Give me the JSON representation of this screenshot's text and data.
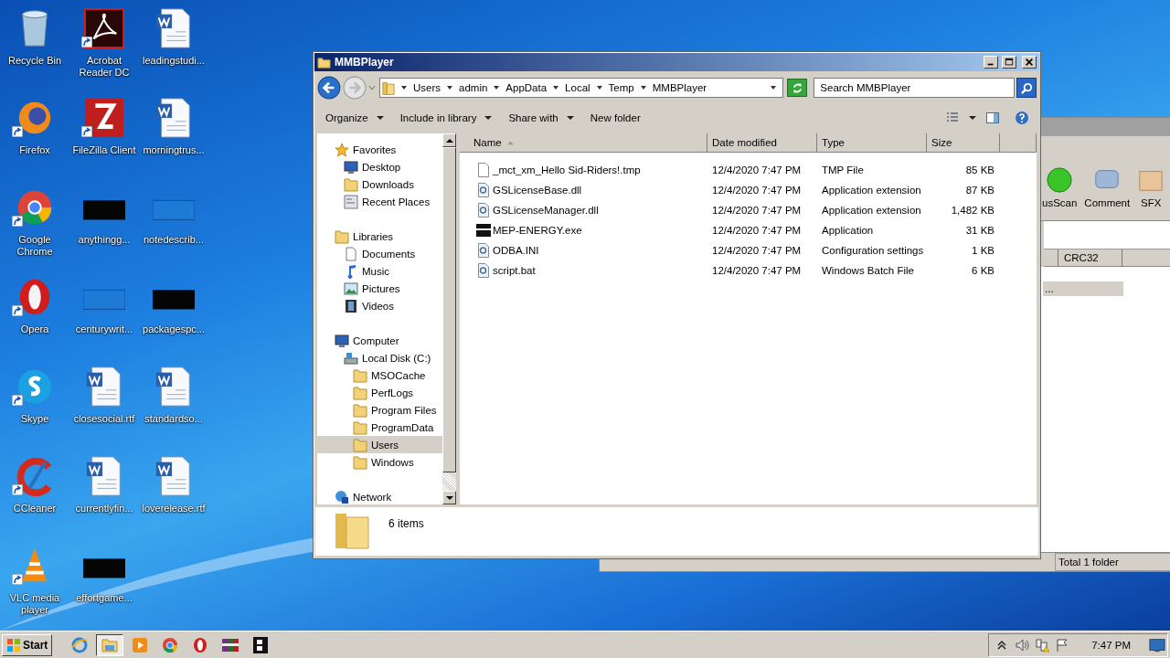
{
  "desktop_icons": [
    {
      "label": "Recycle Bin",
      "kind": "recycle",
      "shortcut": false
    },
    {
      "label": "Firefox",
      "kind": "firefox",
      "shortcut": true
    },
    {
      "label": "Google Chrome",
      "kind": "chrome",
      "shortcut": true
    },
    {
      "label": "Opera",
      "kind": "opera",
      "shortcut": true
    },
    {
      "label": "Skype",
      "kind": "skype",
      "shortcut": true
    },
    {
      "label": "CCleaner",
      "kind": "ccleaner",
      "shortcut": true
    },
    {
      "label": "VLC media player",
      "kind": "vlc",
      "shortcut": true
    },
    {
      "label": "Acrobat Reader DC",
      "kind": "acrobat",
      "shortcut": true
    },
    {
      "label": "FileZilla Client",
      "kind": "filezilla",
      "shortcut": true
    },
    {
      "label": "anythingg...",
      "kind": "dark",
      "shortcut": false
    },
    {
      "label": "centurywrit...",
      "kind": "light",
      "shortcut": false
    },
    {
      "label": "closesocial.rtf",
      "kind": "word",
      "shortcut": false
    },
    {
      "label": "currentlyfin...",
      "kind": "word",
      "shortcut": false
    },
    {
      "label": "effortgame...",
      "kind": "dark",
      "shortcut": false
    },
    {
      "label": "leadingstudi...",
      "kind": "word",
      "shortcut": false
    },
    {
      "label": "morningtrus...",
      "kind": "word",
      "shortcut": false
    },
    {
      "label": "notedescrib...",
      "kind": "light",
      "shortcut": false
    },
    {
      "label": "packagespc...",
      "kind": "dark",
      "shortcut": false
    },
    {
      "label": "standardso...",
      "kind": "word",
      "shortcut": false
    },
    {
      "label": "loverelease.rtf",
      "kind": "word",
      "shortcut": false
    }
  ],
  "back_window": {
    "toolbar": [
      "usScan",
      "Comment",
      "SFX"
    ],
    "column": "CRC32",
    "row": "...",
    "status": "Total 1 folder"
  },
  "window": {
    "title": "MMBPlayer",
    "breadcrumb": [
      "Users",
      "admin",
      "AppData",
      "Local",
      "Temp",
      "MMBPlayer"
    ],
    "search": {
      "placeholder": "Search MMBPlayer"
    },
    "commands": [
      {
        "label": "Organize",
        "menu": true
      },
      {
        "label": "Include in library",
        "menu": true
      },
      {
        "label": "Share with",
        "menu": true
      },
      {
        "label": "New folder",
        "menu": false
      }
    ],
    "navigation": [
      {
        "label": "Favorites",
        "kind": "star",
        "selected": false,
        "children": [
          {
            "label": "Desktop",
            "kind": "monitor",
            "selected": false
          },
          {
            "label": "Downloads",
            "kind": "folder",
            "selected": false
          },
          {
            "label": "Recent Places",
            "kind": "recent",
            "selected": false
          }
        ]
      },
      {
        "label": "Libraries",
        "kind": "library",
        "selected": false,
        "children": [
          {
            "label": "Documents",
            "kind": "page",
            "selected": false
          },
          {
            "label": "Music",
            "kind": "note",
            "selected": false
          },
          {
            "label": "Pictures",
            "kind": "image",
            "selected": false
          },
          {
            "label": "Videos",
            "kind": "film",
            "selected": false
          }
        ]
      },
      {
        "label": "Computer",
        "kind": "monitor",
        "selected": false,
        "children": [
          {
            "label": "Local Disk (C:)",
            "kind": "drive",
            "selected": false,
            "children": [
              {
                "label": "MSOCache",
                "kind": "folder",
                "selected": false
              },
              {
                "label": "PerfLogs",
                "kind": "folder",
                "selected": false
              },
              {
                "label": "Program Files",
                "kind": "folder",
                "selected": false
              },
              {
                "label": "ProgramData",
                "kind": "folder",
                "selected": false
              },
              {
                "label": "Users",
                "kind": "folder",
                "selected": true
              },
              {
                "label": "Windows",
                "kind": "folder",
                "selected": false
              }
            ]
          }
        ]
      },
      {
        "label": "Network",
        "kind": "globe",
        "selected": false
      }
    ],
    "columns": [
      "Name",
      "Date modified",
      "Type",
      "Size"
    ],
    "files": [
      {
        "name": "_mct_xm_Hello Sid-Riders!.tmp",
        "date": "12/4/2020 7:47 PM",
        "type": "TMP File",
        "size": "85 KB",
        "kind": "page"
      },
      {
        "name": "GSLicenseBase.dll",
        "date": "12/4/2020 7:47 PM",
        "type": "Application extension",
        "size": "87 KB",
        "kind": "gear"
      },
      {
        "name": "GSLicenseManager.dll",
        "date": "12/4/2020 7:47 PM",
        "type": "Application extension",
        "size": "1,482 KB",
        "kind": "gear"
      },
      {
        "name": "MEP-ENERGY.exe",
        "date": "12/4/2020 7:47 PM",
        "type": "Application",
        "size": "31 KB",
        "kind": "exe"
      },
      {
        "name": "ODBA.INI",
        "date": "12/4/2020 7:47 PM",
        "type": "Configuration settings",
        "size": "1 KB",
        "kind": "gear"
      },
      {
        "name": "script.bat",
        "date": "12/4/2020 7:47 PM",
        "type": "Windows Batch File",
        "size": "6 KB",
        "kind": "gear"
      }
    ],
    "details": "6 items"
  },
  "taskbar": {
    "start": "Start",
    "items": [
      {
        "kind": "ie",
        "selected": false
      },
      {
        "kind": "explorer",
        "selected": true
      },
      {
        "kind": "media",
        "selected": false
      },
      {
        "kind": "chrome",
        "selected": false
      },
      {
        "kind": "opera",
        "selected": false
      },
      {
        "kind": "winrar",
        "selected": false
      },
      {
        "kind": "film",
        "selected": false
      }
    ],
    "clock": "7:47 PM"
  }
}
